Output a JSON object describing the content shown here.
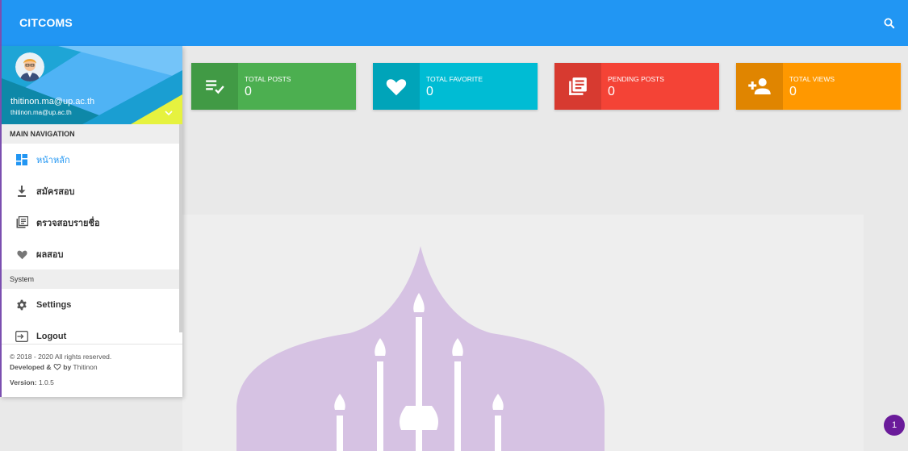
{
  "app": {
    "brand": "CITCOMS"
  },
  "user": {
    "name": "thitinon.ma@up.ac.th",
    "email": "thitinon.ma@up.ac.th"
  },
  "nav": {
    "main_header": "MAIN NAVIGATION",
    "items": [
      {
        "label": "หน้าหลัก",
        "icon": "dashboard-icon",
        "active": true
      },
      {
        "label": "สมัครสอบ",
        "icon": "download-icon"
      },
      {
        "label": "ตรวจสอบรายชื่อ",
        "icon": "list-icon"
      },
      {
        "label": "ผลสอบ",
        "icon": "heart-icon"
      }
    ],
    "system_header": "System",
    "system_items": [
      {
        "label": "Settings",
        "icon": "gear-icon"
      },
      {
        "label": "Logout",
        "icon": "logout-icon"
      }
    ]
  },
  "footer": {
    "copyright": "© 2018 - 2020 All rights reserved.",
    "developed_prefix": "Developed &",
    "developed_by": "by",
    "developer": "Thitinon",
    "version_label": "Version:",
    "version": "1.0.5"
  },
  "stats": [
    {
      "title": "TOTAL POSTS",
      "value": "0",
      "color": "#4caf50",
      "icon_bg": "#419a45",
      "icon": "playlist-check-icon"
    },
    {
      "title": "TOTAL FAVORITE",
      "value": "0",
      "color": "#00bcd4",
      "icon_bg": "#00a4b9",
      "icon": "heart-icon"
    },
    {
      "title": "PENDING POSTS",
      "value": "0",
      "color": "#f44336",
      "icon_bg": "#d73a30",
      "icon": "library-books-icon"
    },
    {
      "title": "TOTAL VIEWS",
      "value": "0",
      "color": "#ff9800",
      "icon_bg": "#e08500",
      "icon": "person-add-icon"
    }
  ],
  "notification": {
    "count": "1"
  }
}
